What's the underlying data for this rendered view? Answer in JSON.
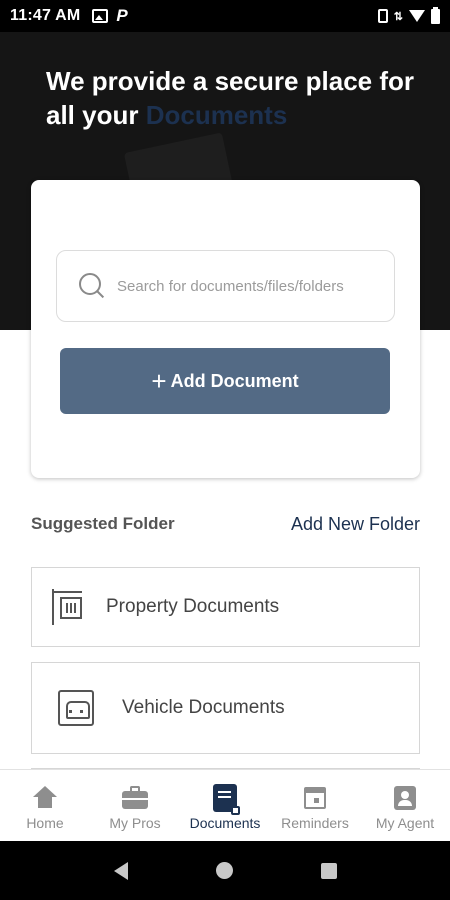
{
  "status_bar": {
    "time": "11:47 AM",
    "left_icons": [
      "image-icon",
      "parking-icon"
    ],
    "parking_glyph": "P",
    "right_icons": [
      "vibrate-icon",
      "data-icon",
      "wifi-icon",
      "battery-icon"
    ]
  },
  "hero": {
    "title_line_1": "We provide a secure place for",
    "title_line_2_prefix": "all your ",
    "title_accent": "Documents"
  },
  "search": {
    "placeholder": "Search for documents/files/folders",
    "value": ""
  },
  "actions": {
    "add_document_label": "Add Document",
    "add_icon": "+"
  },
  "suggested": {
    "title": "Suggested Folder",
    "add_new_label": "Add New Folder",
    "folders": [
      {
        "label": "Property Documents",
        "icon": "building-icon"
      },
      {
        "label": "Vehicle Documents",
        "icon": "car-icon"
      }
    ]
  },
  "bottom_nav": {
    "items": [
      {
        "label": "Home",
        "icon": "home-icon",
        "active": false
      },
      {
        "label": "My Pros",
        "icon": "briefcase-icon",
        "active": false
      },
      {
        "label": "Documents",
        "icon": "document-icon",
        "active": true
      },
      {
        "label": "Reminders",
        "icon": "calendar-icon",
        "active": false
      },
      {
        "label": "My Agent",
        "icon": "agent-icon",
        "active": false
      }
    ]
  },
  "colors": {
    "accent": "#1c3150",
    "button": "#536a85",
    "hero_bg": "#151515"
  }
}
